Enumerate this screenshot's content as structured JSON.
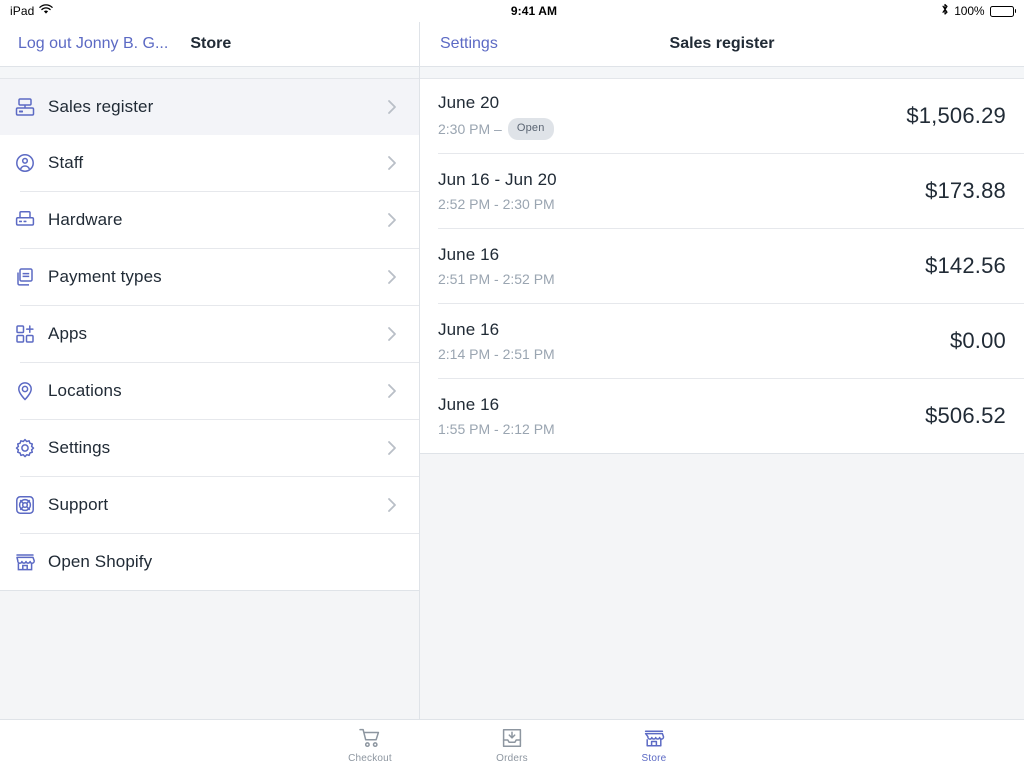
{
  "statusbar": {
    "device": "iPad",
    "wifi_icon": "wifi-icon",
    "time": "9:41 AM",
    "bluetooth_icon": "bluetooth-icon",
    "battery_percent": "100%",
    "battery_icon": "battery-full-icon"
  },
  "sidebar_nav": {
    "logout_label": "Log out Jonny B. G...",
    "title": "Store"
  },
  "detail_nav": {
    "back_label": "Settings",
    "title": "Sales register"
  },
  "sidebar": {
    "items": [
      {
        "label": "Sales register",
        "icon": "cash-register-icon",
        "active": true,
        "chevron": true
      },
      {
        "label": "Staff",
        "icon": "staff-person-icon",
        "active": false,
        "chevron": true
      },
      {
        "label": "Hardware",
        "icon": "printer-icon",
        "active": false,
        "chevron": true
      },
      {
        "label": "Payment types",
        "icon": "payment-card-icon",
        "active": false,
        "chevron": true
      },
      {
        "label": "Apps",
        "icon": "apps-grid-plus-icon",
        "active": false,
        "chevron": true
      },
      {
        "label": "Locations",
        "icon": "map-pin-icon",
        "active": false,
        "chevron": true
      },
      {
        "label": "Settings",
        "icon": "gear-icon",
        "active": false,
        "chevron": true
      },
      {
        "label": "Support",
        "icon": "life-ring-icon",
        "active": false,
        "chevron": true
      },
      {
        "label": "Open Shopify",
        "icon": "storefront-icon",
        "active": false,
        "chevron": false
      }
    ]
  },
  "register_list": {
    "rows": [
      {
        "date": "June 20",
        "time": "2:30 PM – ",
        "badge": "Open",
        "amount": "$1,506.29"
      },
      {
        "date": "Jun 16 - Jun 20",
        "time": "2:52 PM - 2:30 PM",
        "badge": "",
        "amount": "$173.88"
      },
      {
        "date": "June 16",
        "time": "2:51 PM - 2:52 PM",
        "badge": "",
        "amount": "$142.56"
      },
      {
        "date": "June 16",
        "time": "2:14 PM - 2:51 PM",
        "badge": "",
        "amount": "$0.00"
      },
      {
        "date": "June 16",
        "time": "1:55 PM - 2:12 PM",
        "badge": "",
        "amount": "$506.52"
      }
    ]
  },
  "tabbar": {
    "tabs": [
      {
        "label": "Checkout",
        "icon": "shopping-cart-icon",
        "active": false
      },
      {
        "label": "Orders",
        "icon": "inbox-download-icon",
        "active": false
      },
      {
        "label": "Store",
        "icon": "storefront-icon",
        "active": true
      }
    ]
  },
  "colors": {
    "accent": "#5c6ac4",
    "text": "#212b36",
    "muted": "#9aa5b1",
    "background": "#f4f5f7",
    "divider": "#e6e8ec",
    "badge_bg": "#dfe3e8"
  }
}
